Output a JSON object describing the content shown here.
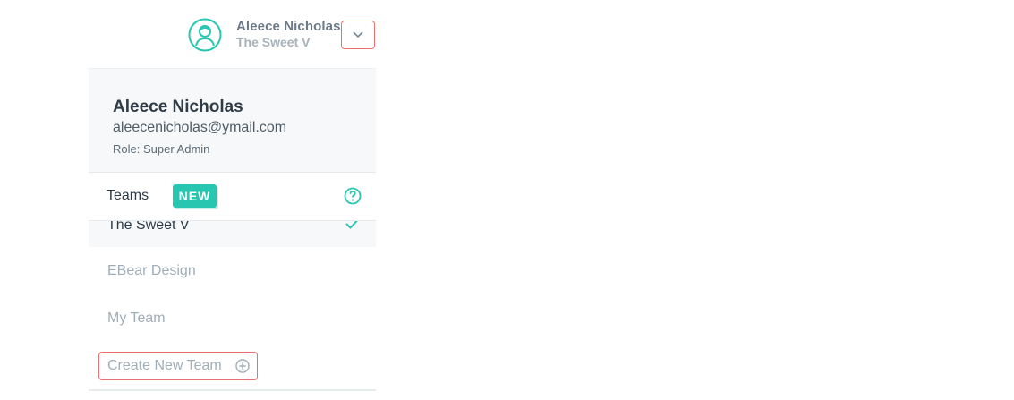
{
  "header": {
    "user_name": "Aleece Nicholas",
    "current_team": "The Sweet V",
    "avatar_icon": "user-avatar-icon",
    "dropdown_icon": "chevron-down-icon"
  },
  "profile": {
    "name": "Aleece Nicholas",
    "email": "aleecenicholas@ymail.com",
    "role": "Role: Super Admin"
  },
  "teams": {
    "label": "Teams",
    "badge": "NEW",
    "help_icon": "question-circle-icon",
    "items": [
      {
        "label": "The Sweet V",
        "selected": true
      },
      {
        "label": "EBear Design",
        "selected": false
      },
      {
        "label": "My Team",
        "selected": false
      }
    ],
    "create_label": "Create New Team",
    "create_icon": "plus-circle-icon"
  },
  "colors": {
    "accent": "#26c6b0",
    "highlight_border": "#ec6f72",
    "text_dark": "#2f3c48",
    "text_muted": "#a0aeb8"
  }
}
